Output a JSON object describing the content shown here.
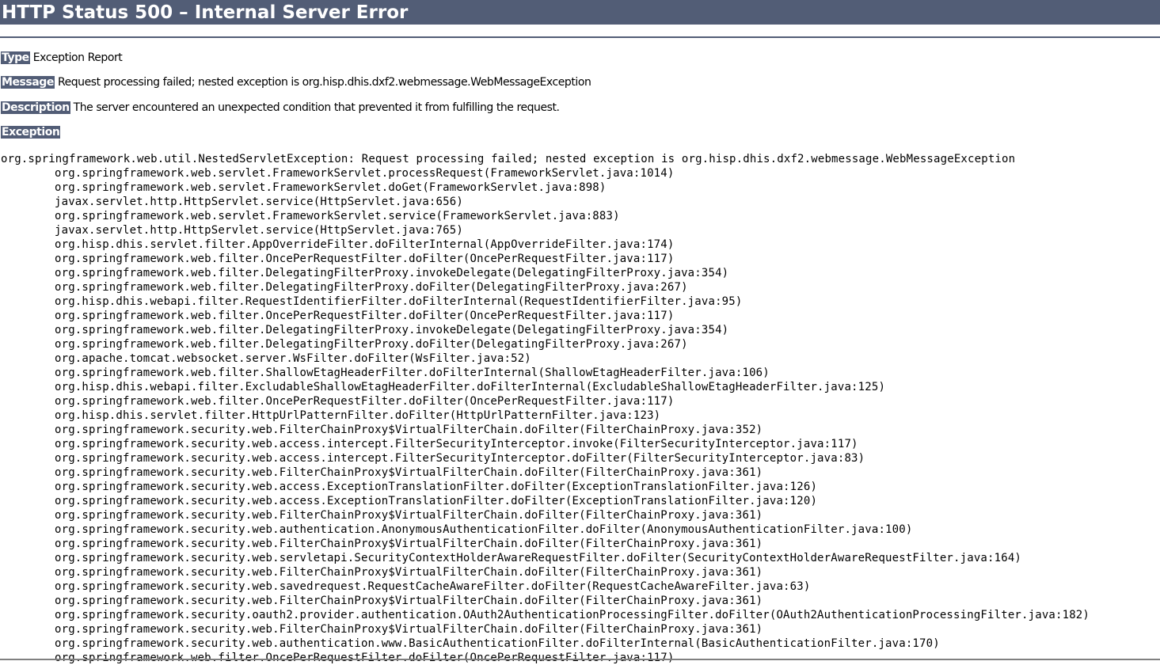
{
  "page": {
    "title": "HTTP Status 500 – Internal Server Error"
  },
  "report": {
    "type": {
      "label": "Type",
      "value": "Exception Report"
    },
    "message": {
      "label": "Message",
      "value": "Request processing failed; nested exception is org.hisp.dhis.dxf2.webmessage.WebMessageException"
    },
    "description": {
      "label": "Description",
      "value": "The server encountered an unexpected condition that prevented it from fulfilling the request."
    },
    "exception": {
      "label": "Exception"
    }
  },
  "stack_trace": {
    "header": "org.springframework.web.util.NestedServletException: Request processing failed; nested exception is org.hisp.dhis.dxf2.webmessage.WebMessageException",
    "frames": [
      "org.springframework.web.servlet.FrameworkServlet.processRequest(FrameworkServlet.java:1014)",
      "org.springframework.web.servlet.FrameworkServlet.doGet(FrameworkServlet.java:898)",
      "javax.servlet.http.HttpServlet.service(HttpServlet.java:656)",
      "org.springframework.web.servlet.FrameworkServlet.service(FrameworkServlet.java:883)",
      "javax.servlet.http.HttpServlet.service(HttpServlet.java:765)",
      "org.hisp.dhis.servlet.filter.AppOverrideFilter.doFilterInternal(AppOverrideFilter.java:174)",
      "org.springframework.web.filter.OncePerRequestFilter.doFilter(OncePerRequestFilter.java:117)",
      "org.springframework.web.filter.DelegatingFilterProxy.invokeDelegate(DelegatingFilterProxy.java:354)",
      "org.springframework.web.filter.DelegatingFilterProxy.doFilter(DelegatingFilterProxy.java:267)",
      "org.hisp.dhis.webapi.filter.RequestIdentifierFilter.doFilterInternal(RequestIdentifierFilter.java:95)",
      "org.springframework.web.filter.OncePerRequestFilter.doFilter(OncePerRequestFilter.java:117)",
      "org.springframework.web.filter.DelegatingFilterProxy.invokeDelegate(DelegatingFilterProxy.java:354)",
      "org.springframework.web.filter.DelegatingFilterProxy.doFilter(DelegatingFilterProxy.java:267)",
      "org.apache.tomcat.websocket.server.WsFilter.doFilter(WsFilter.java:52)",
      "org.springframework.web.filter.ShallowEtagHeaderFilter.doFilterInternal(ShallowEtagHeaderFilter.java:106)",
      "org.hisp.dhis.webapi.filter.ExcludableShallowEtagHeaderFilter.doFilterInternal(ExcludableShallowEtagHeaderFilter.java:125)",
      "org.springframework.web.filter.OncePerRequestFilter.doFilter(OncePerRequestFilter.java:117)",
      "org.hisp.dhis.servlet.filter.HttpUrlPatternFilter.doFilter(HttpUrlPatternFilter.java:123)",
      "org.springframework.security.web.FilterChainProxy$VirtualFilterChain.doFilter(FilterChainProxy.java:352)",
      "org.springframework.security.web.access.intercept.FilterSecurityInterceptor.invoke(FilterSecurityInterceptor.java:117)",
      "org.springframework.security.web.access.intercept.FilterSecurityInterceptor.doFilter(FilterSecurityInterceptor.java:83)",
      "org.springframework.security.web.FilterChainProxy$VirtualFilterChain.doFilter(FilterChainProxy.java:361)",
      "org.springframework.security.web.access.ExceptionTranslationFilter.doFilter(ExceptionTranslationFilter.java:126)",
      "org.springframework.security.web.access.ExceptionTranslationFilter.doFilter(ExceptionTranslationFilter.java:120)",
      "org.springframework.security.web.FilterChainProxy$VirtualFilterChain.doFilter(FilterChainProxy.java:361)",
      "org.springframework.security.web.authentication.AnonymousAuthenticationFilter.doFilter(AnonymousAuthenticationFilter.java:100)",
      "org.springframework.security.web.FilterChainProxy$VirtualFilterChain.doFilter(FilterChainProxy.java:361)",
      "org.springframework.security.web.servletapi.SecurityContextHolderAwareRequestFilter.doFilter(SecurityContextHolderAwareRequestFilter.java:164)",
      "org.springframework.security.web.FilterChainProxy$VirtualFilterChain.doFilter(FilterChainProxy.java:361)",
      "org.springframework.security.web.savedrequest.RequestCacheAwareFilter.doFilter(RequestCacheAwareFilter.java:63)",
      "org.springframework.security.web.FilterChainProxy$VirtualFilterChain.doFilter(FilterChainProxy.java:361)",
      "org.springframework.security.oauth2.provider.authentication.OAuth2AuthenticationProcessingFilter.doFilter(OAuth2AuthenticationProcessingFilter.java:182)",
      "org.springframework.security.web.FilterChainProxy$VirtualFilterChain.doFilter(FilterChainProxy.java:361)",
      "org.springframework.security.web.authentication.www.BasicAuthenticationFilter.doFilterInternal(BasicAuthenticationFilter.java:170)",
      "org.springframework.web.filter.OncePerRequestFilter.doFilter(OncePerRequestFilter.java:117)"
    ]
  },
  "colors": {
    "header_background": "#525d76",
    "header_text": "#ffffff",
    "body_text": "#000000",
    "page_background": "#ffffff"
  }
}
